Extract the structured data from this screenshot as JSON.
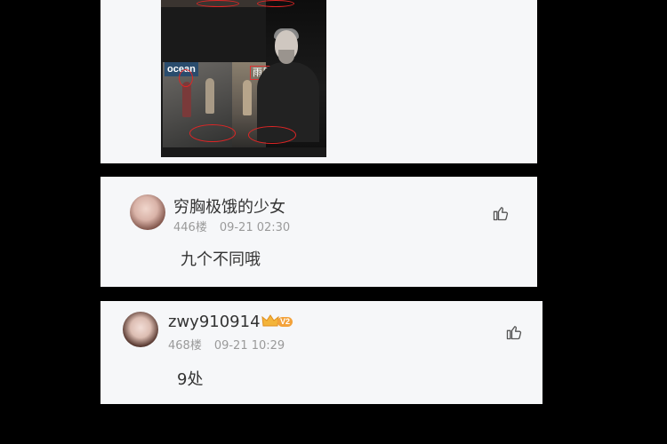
{
  "comments": [
    {
      "username": "穷胸极饿的少女",
      "floor": "446楼",
      "time": "09-21 02:30",
      "content": "九个不同哦"
    },
    {
      "username": "zwy910914",
      "vip_badge": "V2",
      "floor": "468楼",
      "time": "09-21 10:29",
      "content": "9处"
    }
  ],
  "comic": {
    "sign_left": "ocean",
    "sign_right": "雨风"
  },
  "icons": {
    "like": "thumbs-up-icon",
    "crown": "crown-icon"
  },
  "colors": {
    "background": "#000000",
    "card": "#f6f7f9",
    "text": "#333333",
    "meta": "#9a9a9a",
    "crown": "#f3a23a",
    "annotation": "#e02525"
  }
}
